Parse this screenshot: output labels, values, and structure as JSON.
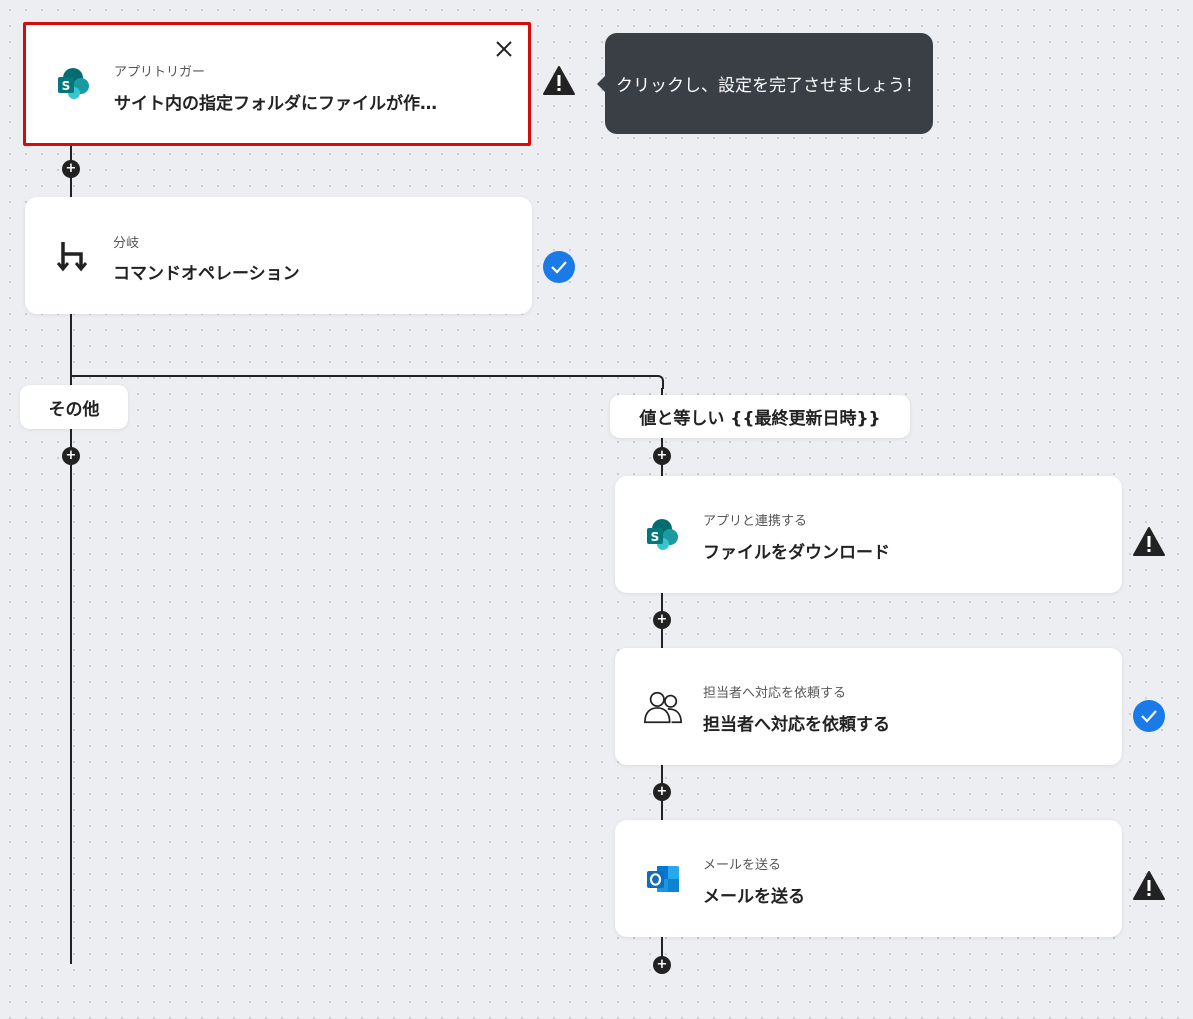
{
  "trigger": {
    "type_label": "アプリトリガー",
    "title": "サイト内の指定フォルダにファイルが作…",
    "app_icon": "sharepoint-icon",
    "status": "warning"
  },
  "tooltip": {
    "text": "クリックし、設定を完了させましょう！"
  },
  "branch": {
    "type_label": "分岐",
    "title": "コマンドオペレーション",
    "status": "complete"
  },
  "branch_labels": {
    "other": "その他",
    "condition": "値と等しい {{最終更新日時}}"
  },
  "steps": [
    {
      "type_label": "アプリと連携する",
      "title": "ファイルをダウンロード",
      "app_icon": "sharepoint-icon",
      "status": "warning"
    },
    {
      "type_label": "担当者へ対応を依頼する",
      "title": "担当者へ対応を依頼する",
      "app_icon": "users-icon",
      "status": "complete"
    },
    {
      "type_label": "メールを送る",
      "title": "メールを送る",
      "app_icon": "outlook-icon",
      "status": "warning"
    }
  ],
  "colors": {
    "selected_border": "#d60b0b",
    "check_blue": "#1a7ae8",
    "tooltip_bg": "#3a3e45",
    "sharepoint_teal": "#036c70",
    "outlook_blue": "#0f6cbd"
  }
}
